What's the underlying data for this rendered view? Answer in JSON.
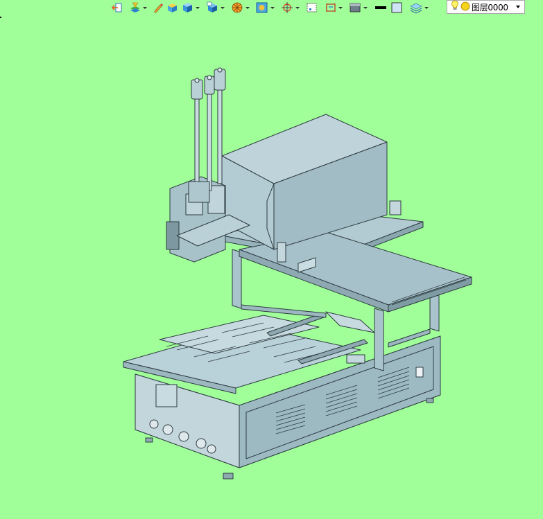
{
  "toolbar": {
    "layer_label": "图层0000",
    "icons": [
      "back-view-icon",
      "layer-filter-icon",
      "sketch-icon",
      "solid-shaded-icon",
      "box-icon",
      "view-cube-icon",
      "render-sphere-icon",
      "orbit-icon",
      "section-icon",
      "frame-icon",
      "dimension-icon",
      "material-icon",
      "line-color-icon",
      "fill-color-icon",
      "layer-stack-icon",
      "lightbulb-icon",
      "layer-status-icon"
    ]
  },
  "colors": {
    "background": "#a0ff98",
    "model_fill": "#a7c7d0",
    "model_stroke": "#2d3a40"
  }
}
